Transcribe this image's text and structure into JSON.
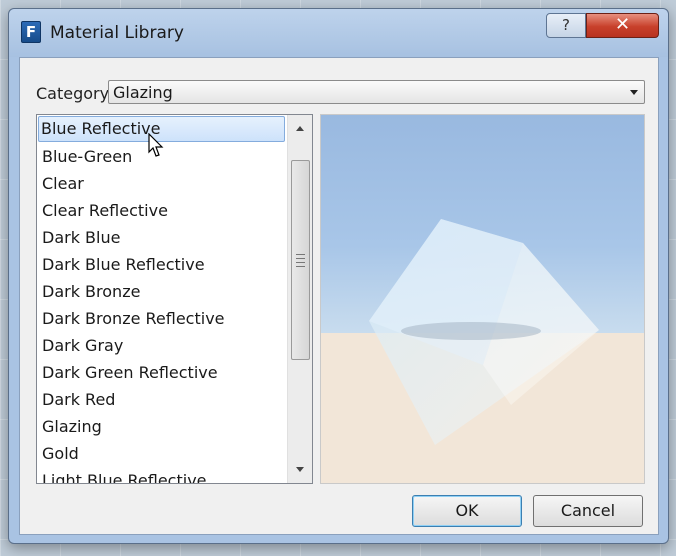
{
  "window": {
    "title": "Material Library",
    "app_icon_letter": "F",
    "help_label": "?",
    "close_label": "✕"
  },
  "category": {
    "label": "Category",
    "value": "Glazing"
  },
  "materials": {
    "selected_index": 0,
    "items": [
      "Blue Reflective",
      "Blue-Green",
      "Clear",
      "Clear Reflective",
      "Dark Blue",
      "Dark Blue Reflective",
      "Dark Bronze",
      "Dark Bronze Reflective",
      "Dark Gray",
      "Dark Green Reflective",
      "Dark Red",
      "Glazing",
      "Gold",
      "Light Blue Reflective"
    ]
  },
  "buttons": {
    "ok": "OK",
    "cancel": "Cancel"
  },
  "colors": {
    "selection": "#cde2fb",
    "sky": "#9ebfe3",
    "ground": "#f2e6d8"
  }
}
